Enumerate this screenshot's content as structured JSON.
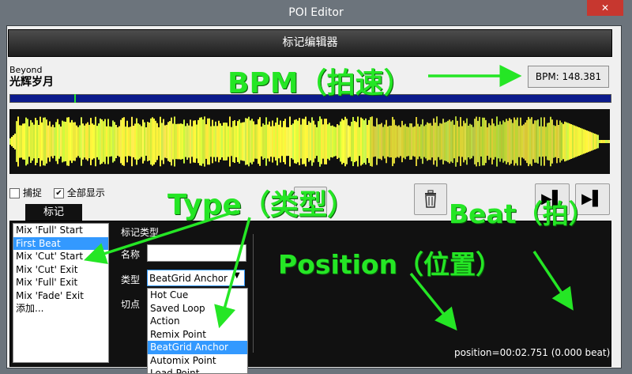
{
  "window": {
    "title": "POI Editor",
    "close_glyph": "✕"
  },
  "header": {
    "title": "标记编辑器"
  },
  "track": {
    "artist": "Beyond",
    "title": "光辉岁月"
  },
  "bpm": {
    "label": "BPM: 148.381"
  },
  "options": {
    "snap_label": "捕捉",
    "show_all_label": "全部显示",
    "show_all_checked": "✔"
  },
  "toolbar": {
    "delete_icon": "delete-icon",
    "play_glyph": "▶▌",
    "next_glyph": "▶▌"
  },
  "tab": {
    "label": "标记"
  },
  "poi_list": {
    "items": [
      "Mix 'Full' Start",
      "First Beat",
      "Mix 'Cut' Start",
      "Mix 'Cut' Exit",
      "Mix 'Full' Exit",
      "Mix 'Fade' Exit",
      "添加..."
    ],
    "selected_index": 1
  },
  "form": {
    "type_heading": "标记类型",
    "name_label": "名称",
    "name_value": "",
    "type_label": "类型",
    "type_value": "BeatGrid Anchor",
    "cut_label": "切点"
  },
  "type_dropdown": {
    "options": [
      "Hot Cue",
      "Saved Loop",
      "Action",
      "Remix Point",
      "BeatGrid Anchor",
      "Automix Point",
      "Load Point"
    ],
    "selected_index": 4
  },
  "status": {
    "position": "position=00:02.751 (0.000 beat)"
  },
  "annotations": {
    "bpm": "BPM（拍速）",
    "type": "Type（类型）",
    "beat": "Beat（拍）",
    "position": "Position（位置）"
  },
  "colors": {
    "annotation": "#25e625",
    "selection": "#3399ff",
    "close": "#c7372f",
    "overview": "#0b1a8c"
  }
}
